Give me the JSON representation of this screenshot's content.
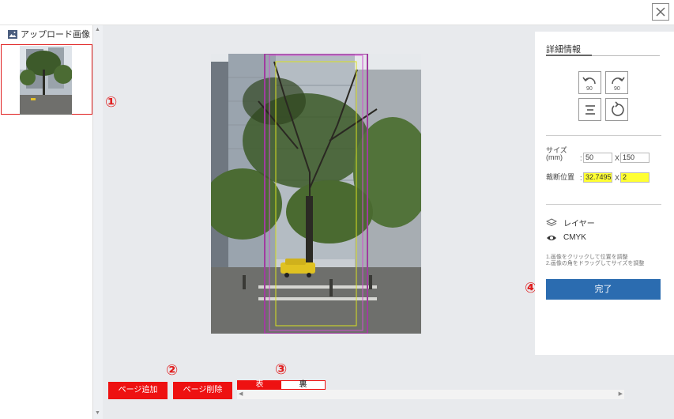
{
  "left_panel": {
    "title": "アップロード画像"
  },
  "annotations": {
    "a1": "①",
    "a2": "②",
    "a3": "③",
    "a4": "④"
  },
  "bottom_bar": {
    "add_page": "ページ追加",
    "delete_page": "ページ削除",
    "front_label": "表",
    "back_label": "裏",
    "selected_face": "表"
  },
  "details": {
    "title": "詳細情報",
    "rotate_left_label": "90",
    "rotate_right_label": "90",
    "size_label_line1": "サイズ",
    "size_label_line2": "(mm)",
    "size_width": "50",
    "size_height": "150",
    "cut_label": "裁断位置",
    "cut_x": "32.7495",
    "cut_y": "2",
    "colon": ":",
    "x_sep": "X",
    "layer_label": "レイヤー",
    "cmyk_label": "CMYK",
    "hint1": "1.画像をクリックして位置を調整",
    "hint2": "2.画像の角をドラッグしてサイズを調整",
    "done_label": "完了"
  },
  "colors": {
    "accent_red": "#ee1111",
    "done_blue": "#2b6cb0",
    "highlight_yellow": "#ffff33"
  },
  "icons": [
    "close-icon",
    "image-icon",
    "rotate-left-icon",
    "rotate-right-icon",
    "align-center-icon",
    "reset-icon",
    "layers-icon",
    "eye-icon"
  ]
}
